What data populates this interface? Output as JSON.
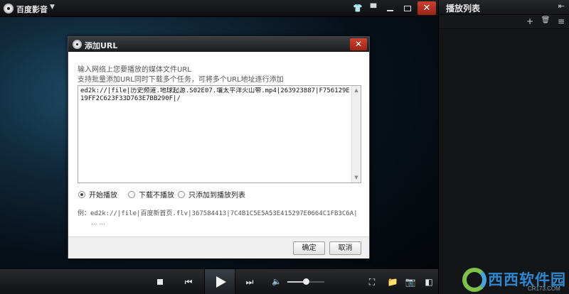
{
  "app": {
    "title": "百度影音",
    "menu_arrow": "▼"
  },
  "titlebar": {
    "skin_icon": "👕",
    "message_icon": "▀",
    "close": "✕"
  },
  "playlist": {
    "title": "播放列表",
    "collapse": "⇤",
    "add": "+",
    "delete": "🗑",
    "more": "≡"
  },
  "dialog": {
    "title": "添加URL",
    "close": "✕",
    "instruction_1": "输入网络上您要播放的媒体文件URL",
    "instruction_2": "支持批量添加URL同时下载多个任务，可将多个URL地址逐行添加",
    "url_value": "ed2k://|file|历史频道.地球起源.S02E07.壤太平洋火山带.mp4|263923887|F756129E19FF2C623F33D763E7BB290F|/",
    "options": [
      {
        "label": "开始播放",
        "selected": true
      },
      {
        "label": "下载不播放",
        "selected": false
      },
      {
        "label": "只添加到播放列表",
        "selected": false
      }
    ],
    "example": "例：ed2k://|file|百度新首页.flv|367584413|7C4B1C5E5A53E415297E0664C1FB3C6A|",
    "ellipsis": "... ...",
    "ok_label": "确定",
    "cancel_label": "取消"
  },
  "controls": {
    "prev": "⏮",
    "next": "⏭",
    "volume_icon": "🔈",
    "volume_level": 0.5,
    "fullscreen": "⛶",
    "folder": "📁",
    "camera": "📷",
    "panel": "◧"
  },
  "watermark": {
    "text": "西西软件园",
    "sub": "CR173.COM"
  }
}
